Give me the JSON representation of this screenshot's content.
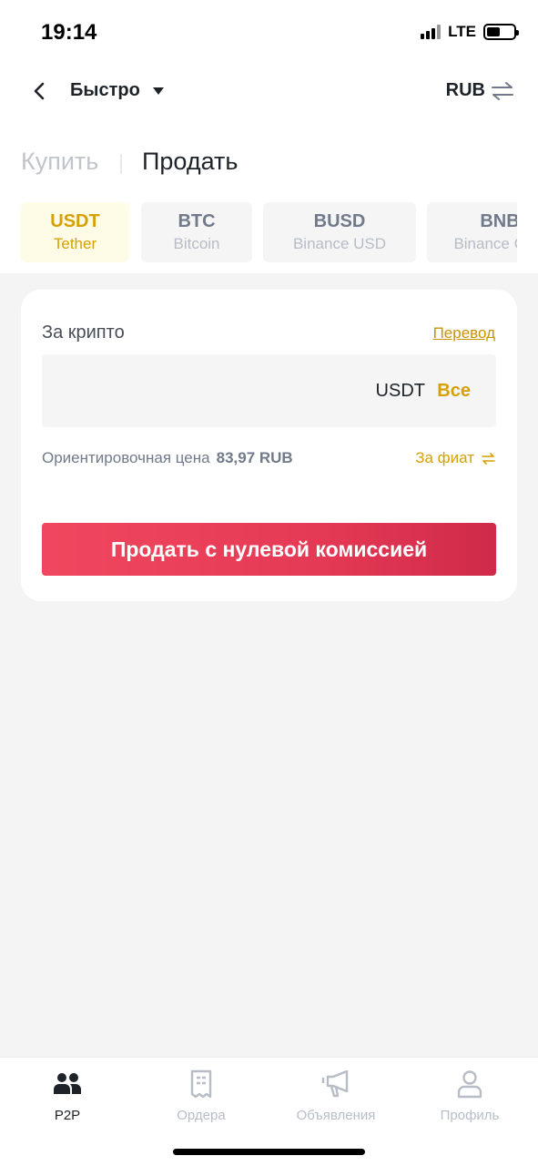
{
  "status_bar": {
    "time": "19:14",
    "network": "LTE",
    "battery_level": 0.5
  },
  "header": {
    "mode": "Быстро",
    "currency": "RUB",
    "back_icon": "chevron-left-icon",
    "swap_icon": "swap-icon"
  },
  "tabs": {
    "buy": "Купить",
    "sell": "Продать",
    "active": "sell"
  },
  "coins": [
    {
      "symbol": "USDT",
      "name": "Tether",
      "active": true
    },
    {
      "symbol": "BTC",
      "name": "Bitcoin",
      "active": false
    },
    {
      "symbol": "BUSD",
      "name": "Binance USD",
      "active": false
    },
    {
      "symbol": "BNB",
      "name": "Binance Coin",
      "active": false
    }
  ],
  "form": {
    "label": "За крипто",
    "transfer_link": "Перевод",
    "input_unit": "USDT",
    "all_button": "Все",
    "price_label": "Ориентировочная цена",
    "price_value": "83,97 RUB",
    "fiat_toggle": "За фиат",
    "submit": "Продать с нулевой комиссией"
  },
  "colors": {
    "accent": "#d6a000",
    "sell": "#e53a55",
    "text": "#1e2329",
    "muted": "#707a8a"
  },
  "bottom_nav": [
    {
      "label": "P2P",
      "icon": "users-icon",
      "active": true
    },
    {
      "label": "Ордера",
      "icon": "receipt-icon",
      "active": false
    },
    {
      "label": "Объявления",
      "icon": "megaphone-icon",
      "active": false
    },
    {
      "label": "Профиль",
      "icon": "user-icon",
      "active": false
    }
  ]
}
